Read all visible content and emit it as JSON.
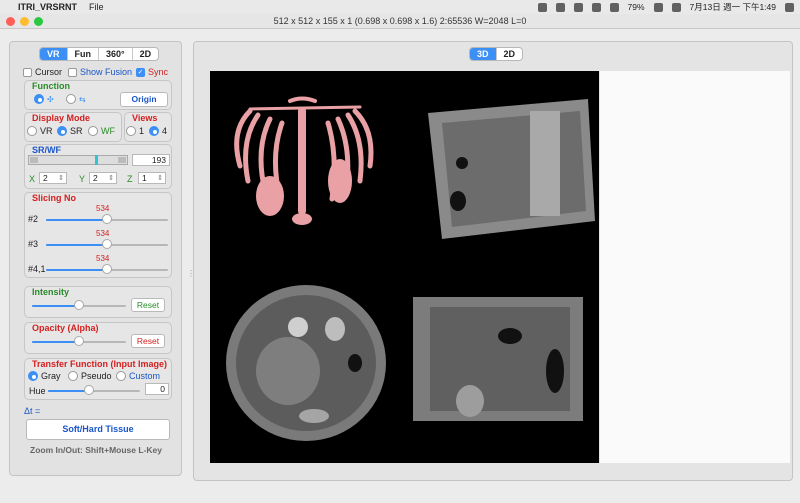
{
  "menubar": {
    "app_name": "ITRI_VRSRNT",
    "menu_file": "File",
    "battery": "79%",
    "clock": "7月13日 週一 下午1:49"
  },
  "window": {
    "title": "512 x 512 x 155 x 1  (0.698 x 0.698 x 1.6) 2:65536 W=2048 L=0"
  },
  "left": {
    "tabs": [
      "VR",
      "Fun",
      "360°",
      "2D"
    ],
    "active_tab": "VR",
    "cursor_label": "Cursor",
    "show_fusion_label": "Show Fusion",
    "sync_label": "Sync",
    "function": {
      "title": "Function",
      "origin_label": "Origin",
      "icon1": "✣",
      "icon2": "⇆"
    },
    "display_mode": {
      "title": "Display Mode",
      "options": [
        "VR",
        "SR",
        "WF"
      ],
      "selected": "SR"
    },
    "views": {
      "title": "Views",
      "options": [
        "1",
        "4"
      ],
      "selected": "4"
    },
    "srwf": {
      "title": "SR/WF",
      "value": "193",
      "x_label": "X",
      "x_value": "2",
      "y_label": "Y",
      "y_value": "2",
      "z_label": "Z",
      "z_value": "1"
    },
    "slicing": {
      "title": "Slicing No",
      "rows": [
        {
          "label": "#2",
          "value": "534",
          "level": 0.5
        },
        {
          "label": "#3",
          "value": "534",
          "level": 0.5
        },
        {
          "label": "#4,1",
          "value": "534",
          "level": 0.5
        }
      ]
    },
    "intensity": {
      "title": "Intensity",
      "reset_label": "Reset",
      "level": 0.5
    },
    "opacity": {
      "title": "Opacity (Alpha)",
      "reset_label": "Reset",
      "level": 0.5
    },
    "transfer": {
      "title": "Transfer Function (Input Image)",
      "options": [
        "Gray",
        "Pseudo",
        "Custom"
      ],
      "selected": "Gray",
      "hue_label": "Hue",
      "hue_value": "0",
      "hue_level": 0.45
    },
    "delta_t": "Δt =",
    "soft_hard_label": "Soft/Hard Tissue",
    "zoom_hint": "Zoom In/Out: Shift+Mouse L-Key"
  },
  "right": {
    "tabs": [
      "3D",
      "2D"
    ],
    "active_tab": "3D"
  },
  "colors": {
    "accent": "#3b8ff5",
    "section_green": "#2a8a2a",
    "section_red": "#d42020",
    "bone_pink": "#e9a1a6"
  }
}
